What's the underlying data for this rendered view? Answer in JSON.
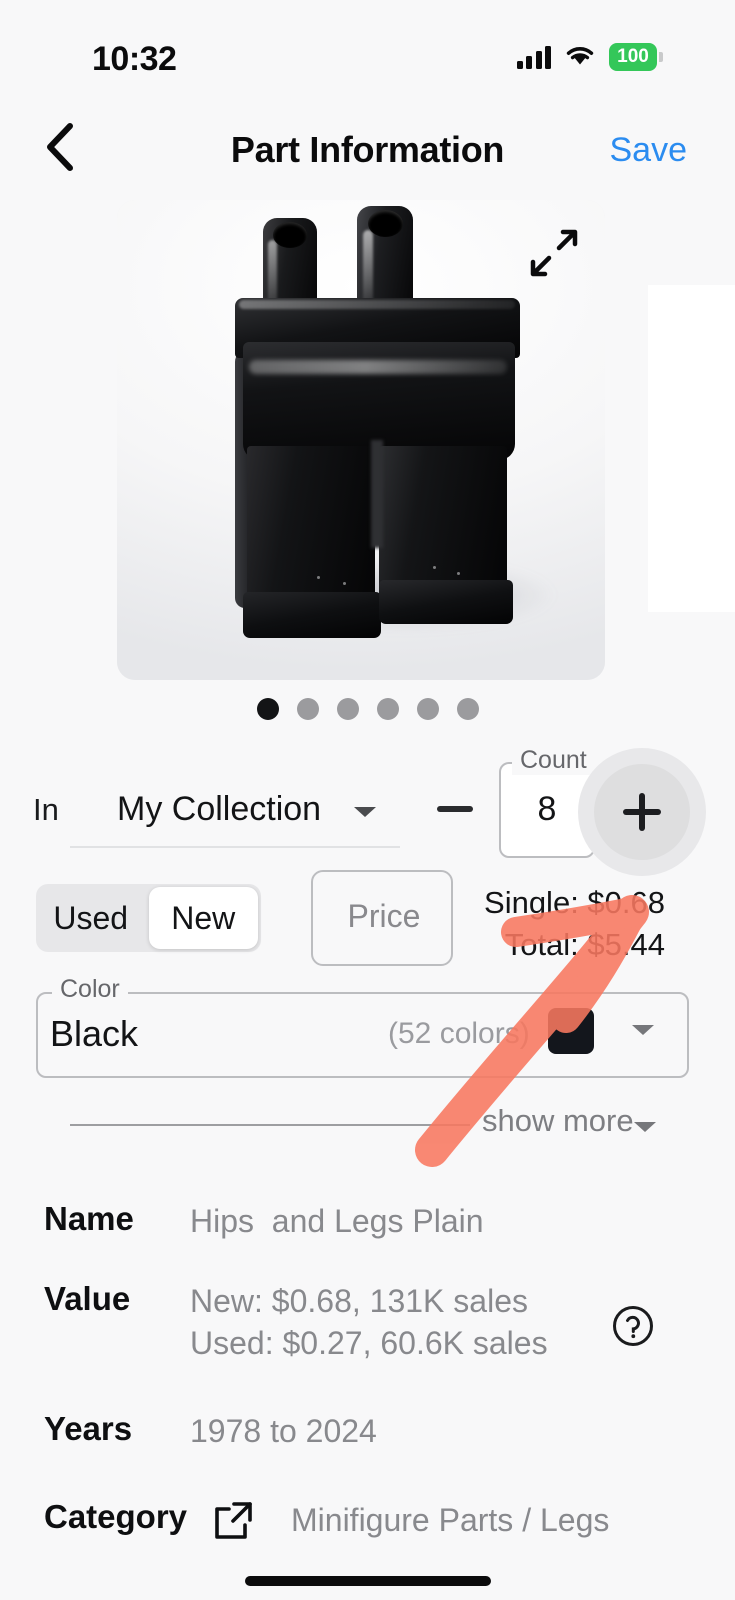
{
  "status_bar": {
    "time": "10:32",
    "battery_level": "100",
    "battery_color": "#34c759",
    "signal_icon": "cellular-signal-icon",
    "wifi_icon": "wifi-icon"
  },
  "nav": {
    "back_icon": "chevron-left-icon",
    "title": "Part Information",
    "save_label": "Save",
    "save_color": "#2b8cf0"
  },
  "carousel": {
    "expand_icon": "expand-arrows-icon",
    "image_alt": "Black LEGO minifigure hips and legs part",
    "dot_count": 6,
    "active_dot": 0
  },
  "collection": {
    "in_label": "In",
    "selected": "My Collection",
    "caret_icon": "chevron-down-icon",
    "minus_icon": "minus-icon",
    "plus_icon": "plus-icon",
    "count_legend": "Count",
    "count_value": "8"
  },
  "condition": {
    "options": [
      "Used",
      "New"
    ],
    "selected": "New",
    "price_placeholder": "Price",
    "price_value": "",
    "single_label": "Single: $0.68",
    "total_label": "Total: $5.44"
  },
  "color": {
    "legend": "Color",
    "value": "Black",
    "count_label": "(52 colors)",
    "swatch_hex": "#13161c",
    "caret_icon": "chevron-down-icon"
  },
  "show_more": {
    "label": "show more",
    "caret_icon": "chevron-down-icon"
  },
  "info": {
    "name_key": "Name",
    "name_value": "Hips  and Legs Plain",
    "value_key": "Value",
    "value_line1": "New: $0.68, 131K sales",
    "value_line2": "Used: $0.27, 60.6K sales",
    "help_icon": "help-circle-icon",
    "years_key": "Years",
    "years_value": "1978 to 2024",
    "category_key": "Category",
    "category_link_icon": "external-link-icon",
    "category_value": "Minifigure Parts / Legs"
  },
  "annotation": {
    "type": "arrow",
    "color": "#f87860",
    "points_to": "plus-button"
  }
}
